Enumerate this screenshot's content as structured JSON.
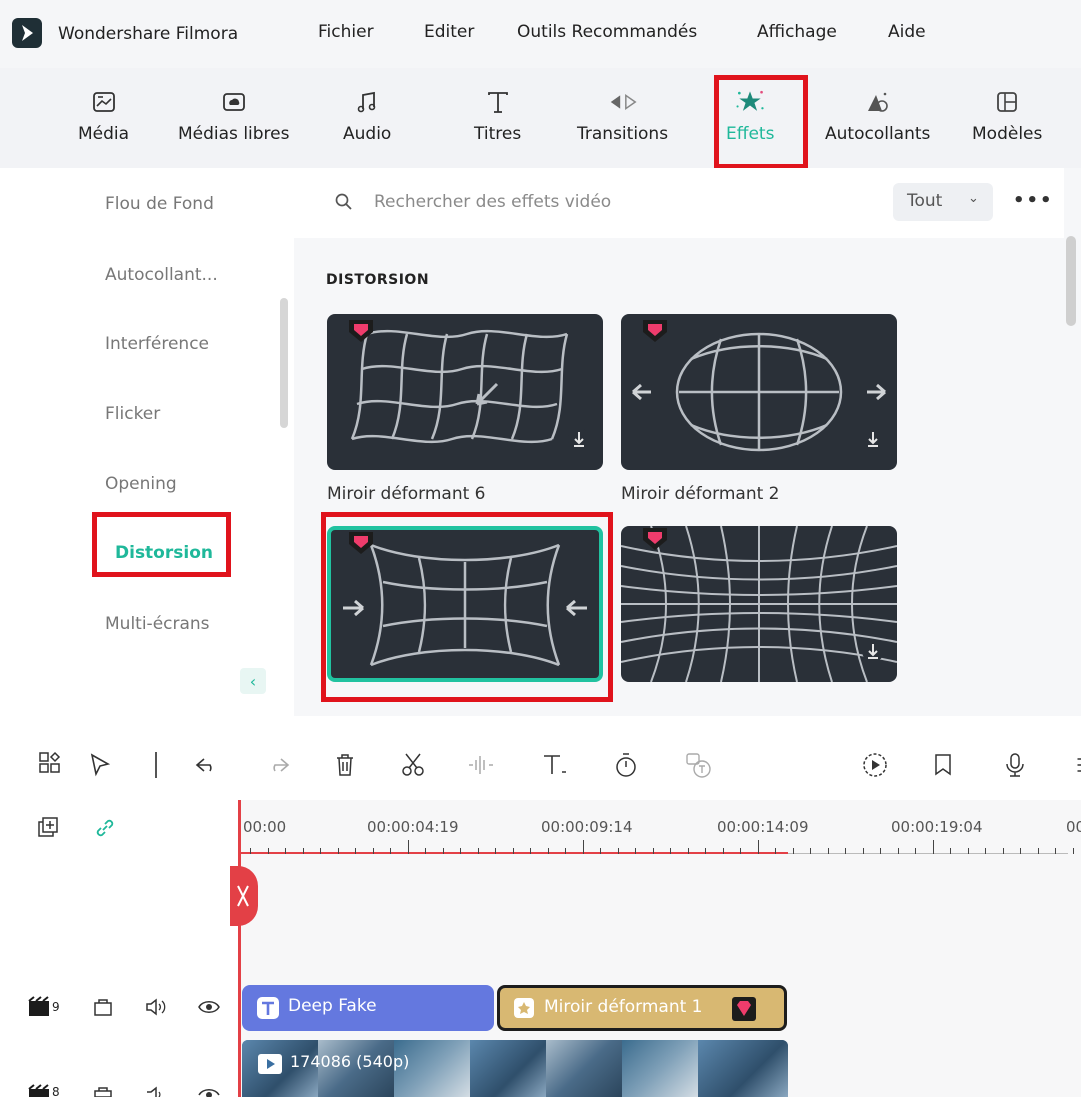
{
  "app": {
    "name": "Wondershare Filmora",
    "menu": [
      "Fichier",
      "Editer",
      "Outils Recommandés",
      "Affichage",
      "Aide"
    ]
  },
  "toolbar": {
    "tabs": [
      {
        "label": "Média",
        "icon": "media-icon"
      },
      {
        "label": "Médias libres",
        "icon": "stock-media-icon"
      },
      {
        "label": "Audio",
        "icon": "music-note-icon"
      },
      {
        "label": "Titres",
        "icon": "text-t-icon"
      },
      {
        "label": "Transitions",
        "icon": "transition-arrows-icon"
      },
      {
        "label": "Effets",
        "icon": "magic-star-icon",
        "active": true
      },
      {
        "label": "Autocollants",
        "icon": "sticker-icon"
      },
      {
        "label": "Modèles",
        "icon": "template-icon"
      }
    ]
  },
  "sidebar": {
    "items": [
      "Flou de Fond",
      "Autocollant...",
      "Interférence",
      "Flicker",
      "Opening",
      "Distorsion",
      "Multi-écrans"
    ],
    "active": "Distorsion"
  },
  "search": {
    "placeholder": "Rechercher des effets vidéo",
    "filter": "Tout"
  },
  "section": {
    "title": "DISTORSION"
  },
  "effects": [
    {
      "label": "Miroir déformant 6",
      "premium": true
    },
    {
      "label": "Miroir déformant 2",
      "premium": true
    },
    {
      "label": "",
      "premium": true,
      "selected": true
    },
    {
      "label": "",
      "premium": true
    }
  ],
  "timeline": {
    "ruler": [
      "00:00",
      "00:00:04:19",
      "00:00:09:14",
      "00:00:14:09",
      "00:00:19:04",
      "00"
    ],
    "tracks": {
      "track9_label": "9",
      "track8_label": "8"
    },
    "clips": {
      "title_clip": "Deep Fake",
      "effect_clip": "Miroir déformant 1",
      "video_clip": "174086 (540p)"
    }
  },
  "colors": {
    "accent": "#1fb89a",
    "highlight_red": "#e0131c",
    "title_clip": "#6478df",
    "effect_clip": "#d8b872",
    "playhead": "#e34046"
  }
}
